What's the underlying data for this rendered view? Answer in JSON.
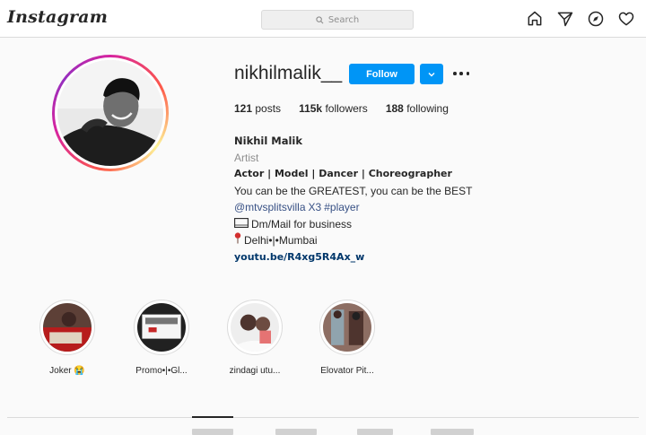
{
  "app": {
    "logo": "Instagram"
  },
  "search": {
    "placeholder": "Search"
  },
  "nav": {
    "icons": [
      "home-icon",
      "direct-icon",
      "explore-icon",
      "activity-icon"
    ]
  },
  "profile": {
    "username": "nikhilmalik__",
    "follow_label": "Follow",
    "stats": {
      "posts_count": "121",
      "posts_label": "posts",
      "followers_count": "115k",
      "followers_label": "followers",
      "following_count": "188",
      "following_label": "following"
    },
    "bio": {
      "full_name": "Nikhil Malik",
      "category": "Artist",
      "roles": "Actor | Model | Dancer | Choreographer",
      "tagline": "You can be the GREATEST, you can be the BEST",
      "mention": "@mtvsplitsvilla",
      "mention_suffix": "X3",
      "hashtag": "#player",
      "contact": "Dm/Mail for business",
      "location": "Delhi•|•Mumbai",
      "website": "youtu.be/R4xg5R4Ax_w"
    }
  },
  "highlights": [
    {
      "label": "Joker 😭"
    },
    {
      "label": "Promo•|•Gl..."
    },
    {
      "label": "zindagi utu..."
    },
    {
      "label": "Elovator Pit..."
    }
  ],
  "colors": {
    "accent": "#0095f6",
    "text": "#262626",
    "muted": "#8e8e8e",
    "link": "#00376b",
    "background": "#fafafa"
  }
}
